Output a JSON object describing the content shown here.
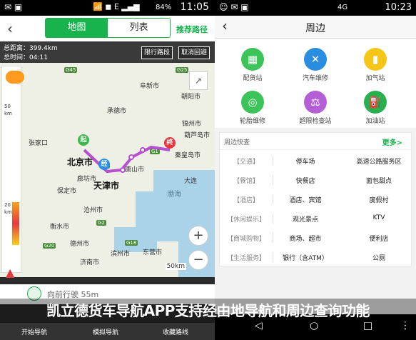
{
  "left": {
    "status": {
      "time": "11:05",
      "battery": "84%"
    },
    "tabs": {
      "map": "地图",
      "list": "列表"
    },
    "recommend_label": "推荐路径",
    "distance_label": "总距离：399.4km",
    "time_label": "总时间：04:11",
    "limit_btn": "限行路段",
    "cancel_btn": "取消回避",
    "cities": {
      "chengde": "承德市",
      "chaoyang": "朝阳市",
      "fuxin": "阜新市",
      "jinzhou": "锦州市",
      "huludao": "葫芦岛市",
      "zhangjiakou": "张家口",
      "beijing": "北京市",
      "tianjin": "天津市",
      "langfang": "廊坊市",
      "tangshan": "唐山市",
      "qinhuangdao": "秦皇岛市",
      "bohai": "渤海",
      "baoding": "保定市",
      "cangzhou": "沧州市",
      "hengshui": "衡水市",
      "dezhou": "德州市",
      "binzhou": "滨州市",
      "jinan": "济南市",
      "dongying": "东营市",
      "dalian": "大连"
    },
    "roads": [
      "G45",
      "G25",
      "G1",
      "G3",
      "G2",
      "G18",
      "G20"
    ],
    "start_label": "起",
    "end_label": "终",
    "via_label": "经",
    "map_scale": "50km",
    "nav_ahead": "向前行驶 55m",
    "bottom": {
      "start": "开始导航",
      "sim": "模拟导航",
      "fav": "收藏路线"
    }
  },
  "right": {
    "status": {
      "time": "10:23",
      "network": "4G"
    },
    "title": "周边",
    "services": [
      {
        "label": "配货站",
        "color": "#3cc35a",
        "icon": "box-icon"
      },
      {
        "label": "汽车维修",
        "color": "#2a8ee0",
        "icon": "wrench-icon"
      },
      {
        "label": "加气站",
        "color": "#f5c518",
        "icon": "gas-icon"
      },
      {
        "label": "轮胎维修",
        "color": "#3cc35a",
        "icon": "tire-icon"
      },
      {
        "label": "超限检查站",
        "color": "#b45fd6",
        "icon": "scale-icon"
      },
      {
        "label": "加油站",
        "color": "#28b04e",
        "icon": "fuel-icon"
      }
    ],
    "nearby_title": "周边快查",
    "more_label": "更多>",
    "rows": [
      {
        "cat": "【交通】",
        "a": "停车场",
        "b": "高速公路服务区"
      },
      {
        "cat": "【餐馆】",
        "a": "快餐店",
        "b": "面包甜点"
      },
      {
        "cat": "【酒店】",
        "a": "酒店、宾馆",
        "b": "度假村"
      },
      {
        "cat": "【休闲娱乐】",
        "a": "观光景点",
        "b": "KTV"
      },
      {
        "cat": "【商城购物】",
        "a": "商场、超市",
        "b": "便利店"
      },
      {
        "cat": "【生活服务】",
        "a": "银行（含ATM）",
        "b": "公厕"
      }
    ]
  },
  "caption": "凯立德货车导航APP支持经由地导航和周边查询功能"
}
